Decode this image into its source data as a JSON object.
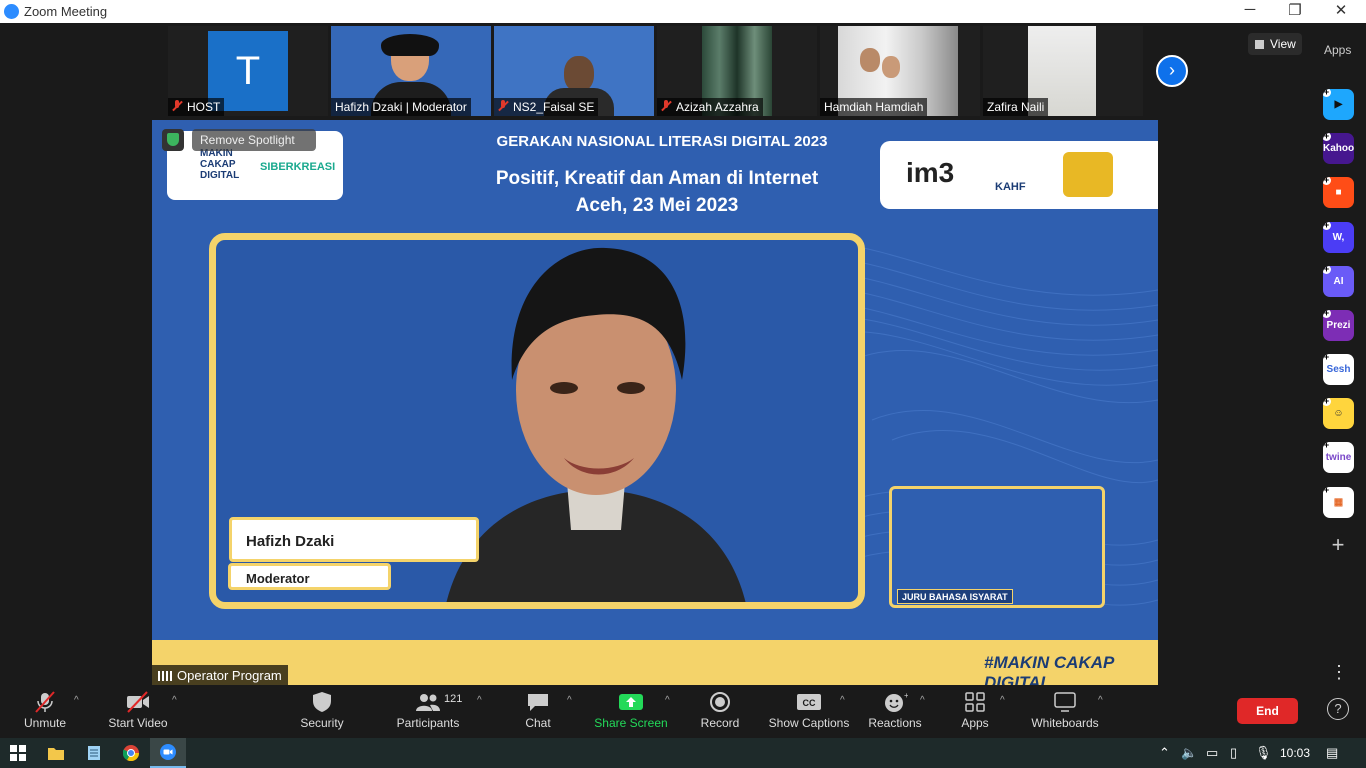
{
  "window": {
    "title": "Zoom Meeting",
    "minimize": "─",
    "restore": "❐",
    "close": "✕"
  },
  "participants_strip": [
    {
      "name": "HOST",
      "muted": true,
      "tile": "avatar",
      "avatar_letter": "T"
    },
    {
      "name": "Hafizh Dzaki | Moderator",
      "muted": false,
      "tile": "video"
    },
    {
      "name": "NS2_Faisal SE",
      "muted": true,
      "tile": "video"
    },
    {
      "name": "Azizah Azzahra",
      "muted": true,
      "tile": "video"
    },
    {
      "name": "Hamdiah Hamdiah",
      "muted": false,
      "tile": "video"
    },
    {
      "name": "Zafira Naili",
      "muted": false,
      "tile": "video"
    }
  ],
  "strip_next_icon": "›",
  "view": {
    "label": "View"
  },
  "apps_panel": {
    "title": "Apps",
    "items": [
      {
        "name": "Asana-like",
        "text": "▶",
        "bg": "#1ea7fd",
        "fg": "#111"
      },
      {
        "name": "Kahoot",
        "text": "Kahoot!",
        "bg": "#46178f",
        "fg": "#fff"
      },
      {
        "name": "Miro-like",
        "text": "■",
        "bg": "#ff4d17",
        "fg": "#fff"
      },
      {
        "name": "Wooclap",
        "text": "W,",
        "bg": "#4b3df5",
        "fg": "#fff"
      },
      {
        "name": "AI assistant",
        "text": "AI",
        "bg": "#6a5bf7",
        "fg": "#fff"
      },
      {
        "name": "Prezi",
        "text": "Prezi",
        "bg": "#7d2db5",
        "fg": "#fff"
      },
      {
        "name": "Sesh",
        "text": "Sesh",
        "bg": "#ffffff",
        "fg": "#3766d9"
      },
      {
        "name": "Emoji game",
        "text": "☺",
        "bg": "#ffd53d",
        "fg": "#333"
      },
      {
        "name": "Twine",
        "text": "twine",
        "bg": "#ffffff",
        "fg": "#7a48c9"
      },
      {
        "name": "Grid app",
        "text": "▦",
        "bg": "#ffffff",
        "fg": "#e56a2a"
      }
    ],
    "add_icon": "+",
    "more_icon": "⋮"
  },
  "spotlight": {
    "remove_label": "Remove Spotlight"
  },
  "slide": {
    "title": "GERAKAN NASIONAL LITERASI DIGITAL 2023",
    "subtitle_line1": "Positif, Kreatif dan Aman di Internet",
    "subtitle_line2": "Aceh, 23 Mei 2023",
    "logo_left_1": "MAKIN\nCAKAP\nDIGITAL",
    "logo_left_2": "SIBERKREASI",
    "logo_right_1": "im3",
    "logo_right_2": "KAHF",
    "speaker_name": "Hafizh Dzaki",
    "speaker_role": "Moderator",
    "sign_label": "JURU BAHASA ISYARAT",
    "hashtag": "#MAKIN CAKAP DIGITAL"
  },
  "active_speaker_label": "Operator Program",
  "toolbar": {
    "unmute": "Unmute",
    "start_video": "Start Video",
    "security": "Security",
    "participants": "Participants",
    "participants_count": "121",
    "chat": "Chat",
    "share_screen": "Share Screen",
    "record": "Record",
    "show_captions": "Show Captions",
    "reactions": "Reactions",
    "apps": "Apps",
    "whiteboards": "Whiteboards",
    "end": "End",
    "help": "?",
    "caret": "^"
  },
  "taskbar": {
    "time": "10:03"
  },
  "colors": {
    "accent": "#0e71eb",
    "share": "#23d959",
    "end": "#e02828",
    "slide_blue": "#2f5fb0",
    "slide_gold": "#f4d36a"
  }
}
